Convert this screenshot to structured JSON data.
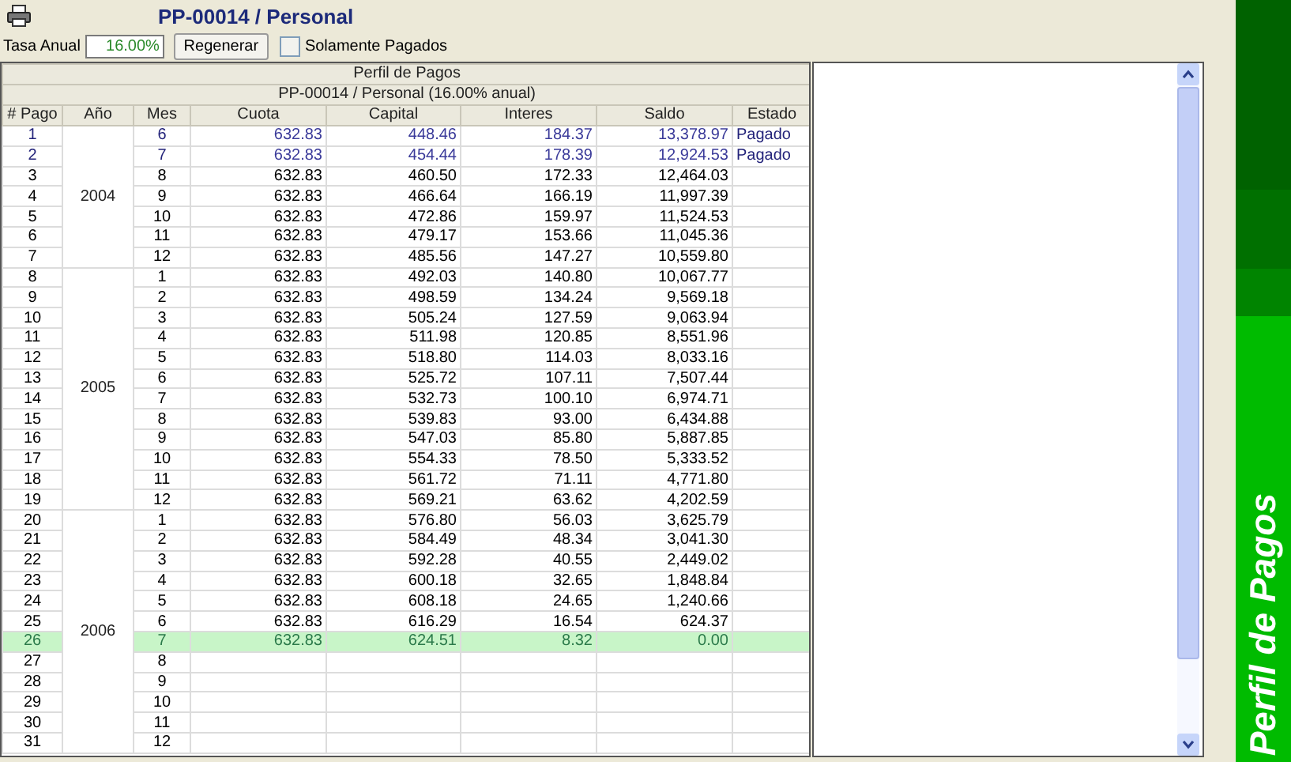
{
  "header": {
    "title": "PP-00014 / Personal"
  },
  "toolbar": {
    "rate_label": "Tasa Anual",
    "rate_value": "16.00%",
    "regenerate_button": "Regenerar",
    "paid_only": {
      "label": "Solamente Pagados",
      "checked": false
    }
  },
  "table": {
    "title": "Perfil de Pagos",
    "subtitle": "PP-00014 / Personal (16.00% anual)",
    "columns": [
      "# Pago",
      "Año",
      "Mes",
      "Cuota",
      "Capital",
      "Interes",
      "Saldo",
      "Estado"
    ],
    "year_groups": [
      {
        "year": "2004",
        "rows": [
          {
            "pago": "1",
            "mes": "6",
            "cuota": "632.83",
            "capital": "448.46",
            "interes": "184.37",
            "saldo": "13,378.97",
            "estado": "Pagado",
            "paid": true,
            "selected": false
          },
          {
            "pago": "2",
            "mes": "7",
            "cuota": "632.83",
            "capital": "454.44",
            "interes": "178.39",
            "saldo": "12,924.53",
            "estado": "Pagado",
            "paid": true,
            "selected": false
          },
          {
            "pago": "3",
            "mes": "8",
            "cuota": "632.83",
            "capital": "460.50",
            "interes": "172.33",
            "saldo": "12,464.03",
            "paid": false,
            "selected": false
          },
          {
            "pago": "4",
            "mes": "9",
            "cuota": "632.83",
            "capital": "466.64",
            "interes": "166.19",
            "saldo": "11,997.39",
            "paid": false,
            "selected": false
          },
          {
            "pago": "5",
            "mes": "10",
            "cuota": "632.83",
            "capital": "472.86",
            "interes": "159.97",
            "saldo": "11,524.53",
            "paid": false,
            "selected": false
          },
          {
            "pago": "6",
            "mes": "11",
            "cuota": "632.83",
            "capital": "479.17",
            "interes": "153.66",
            "saldo": "11,045.36",
            "paid": false,
            "selected": false
          },
          {
            "pago": "7",
            "mes": "12",
            "cuota": "632.83",
            "capital": "485.56",
            "interes": "147.27",
            "saldo": "10,559.80",
            "paid": false,
            "selected": false
          }
        ]
      },
      {
        "year": "2005",
        "rows": [
          {
            "pago": "8",
            "mes": "1",
            "cuota": "632.83",
            "capital": "492.03",
            "interes": "140.80",
            "saldo": "10,067.77",
            "paid": false,
            "selected": false
          },
          {
            "pago": "9",
            "mes": "2",
            "cuota": "632.83",
            "capital": "498.59",
            "interes": "134.24",
            "saldo": "9,569.18",
            "paid": false,
            "selected": false
          },
          {
            "pago": "10",
            "mes": "3",
            "cuota": "632.83",
            "capital": "505.24",
            "interes": "127.59",
            "saldo": "9,063.94",
            "paid": false,
            "selected": false
          },
          {
            "pago": "11",
            "mes": "4",
            "cuota": "632.83",
            "capital": "511.98",
            "interes": "120.85",
            "saldo": "8,551.96",
            "paid": false,
            "selected": false
          },
          {
            "pago": "12",
            "mes": "5",
            "cuota": "632.83",
            "capital": "518.80",
            "interes": "114.03",
            "saldo": "8,033.16",
            "paid": false,
            "selected": false
          },
          {
            "pago": "13",
            "mes": "6",
            "cuota": "632.83",
            "capital": "525.72",
            "interes": "107.11",
            "saldo": "7,507.44",
            "paid": false,
            "selected": false
          },
          {
            "pago": "14",
            "mes": "7",
            "cuota": "632.83",
            "capital": "532.73",
            "interes": "100.10",
            "saldo": "6,974.71",
            "paid": false,
            "selected": false
          },
          {
            "pago": "15",
            "mes": "8",
            "cuota": "632.83",
            "capital": "539.83",
            "interes": "93.00",
            "saldo": "6,434.88",
            "paid": false,
            "selected": false
          },
          {
            "pago": "16",
            "mes": "9",
            "cuota": "632.83",
            "capital": "547.03",
            "interes": "85.80",
            "saldo": "5,887.85",
            "paid": false,
            "selected": false
          },
          {
            "pago": "17",
            "mes": "10",
            "cuota": "632.83",
            "capital": "554.33",
            "interes": "78.50",
            "saldo": "5,333.52",
            "paid": false,
            "selected": false
          },
          {
            "pago": "18",
            "mes": "11",
            "cuota": "632.83",
            "capital": "561.72",
            "interes": "71.11",
            "saldo": "4,771.80",
            "paid": false,
            "selected": false
          },
          {
            "pago": "19",
            "mes": "12",
            "cuota": "632.83",
            "capital": "569.21",
            "interes": "63.62",
            "saldo": "4,202.59",
            "paid": false,
            "selected": false
          }
        ]
      },
      {
        "year": "2006",
        "rows": [
          {
            "pago": "20",
            "mes": "1",
            "cuota": "632.83",
            "capital": "576.80",
            "interes": "56.03",
            "saldo": "3,625.79",
            "paid": false,
            "selected": false
          },
          {
            "pago": "21",
            "mes": "2",
            "cuota": "632.83",
            "capital": "584.49",
            "interes": "48.34",
            "saldo": "3,041.30",
            "paid": false,
            "selected": false
          },
          {
            "pago": "22",
            "mes": "3",
            "cuota": "632.83",
            "capital": "592.28",
            "interes": "40.55",
            "saldo": "2,449.02",
            "paid": false,
            "selected": false
          },
          {
            "pago": "23",
            "mes": "4",
            "cuota": "632.83",
            "capital": "600.18",
            "interes": "32.65",
            "saldo": "1,848.84",
            "paid": false,
            "selected": false
          },
          {
            "pago": "24",
            "mes": "5",
            "cuota": "632.83",
            "capital": "608.18",
            "interes": "24.65",
            "saldo": "1,240.66",
            "paid": false,
            "selected": false
          },
          {
            "pago": "25",
            "mes": "6",
            "cuota": "632.83",
            "capital": "616.29",
            "interes": "16.54",
            "saldo": "624.37",
            "paid": false,
            "selected": false
          },
          {
            "pago": "26",
            "mes": "7",
            "cuota": "632.83",
            "capital": "624.51",
            "interes": "8.32",
            "saldo": "0.00",
            "paid": false,
            "selected": true
          },
          {
            "pago": "27",
            "mes": "8",
            "paid": false,
            "selected": false
          },
          {
            "pago": "28",
            "mes": "9",
            "paid": false,
            "selected": false
          },
          {
            "pago": "29",
            "mes": "10",
            "paid": false,
            "selected": false
          },
          {
            "pago": "30",
            "mes": "11",
            "paid": false,
            "selected": false
          },
          {
            "pago": "31",
            "mes": "12",
            "paid": false,
            "selected": false
          }
        ]
      }
    ]
  },
  "side_banner": {
    "label": "Perfil de Pagos"
  }
}
